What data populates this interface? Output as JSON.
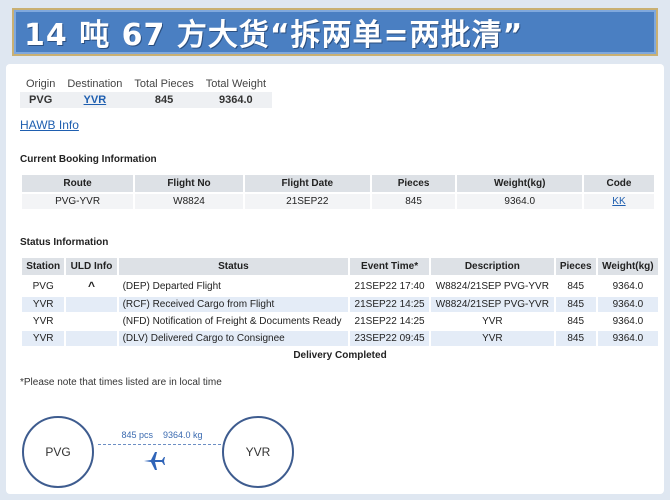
{
  "banner": {
    "text": "14 吨 67 方大货“拆两单=两批清”"
  },
  "summary": {
    "headers": [
      "Origin",
      "Destination",
      "Total Pieces",
      "Total Weight"
    ],
    "values": [
      "PVG",
      "YVR",
      "845",
      "9364.0"
    ]
  },
  "hawb_link": "HAWB Info",
  "booking": {
    "title": "Current Booking Information",
    "headers": [
      "Route",
      "Flight No",
      "Flight Date",
      "Pieces",
      "Weight(kg)",
      "Code"
    ],
    "row": [
      "PVG-YVR",
      "W8824",
      "21SEP22",
      "845",
      "9364.0",
      "KK"
    ]
  },
  "status": {
    "title": "Status Information",
    "headers": [
      "Station",
      "ULD Info",
      "Status",
      "Event Time*",
      "Description",
      "Pieces",
      "Weight(kg)"
    ],
    "rows": [
      {
        "station": "PVG",
        "uld": "^",
        "status": "(DEP) Departed Flight",
        "time": "21SEP22 17:40",
        "desc": "W8824/21SEP PVG-YVR",
        "pieces": "845",
        "weight": "9364.0"
      },
      {
        "station": "YVR",
        "uld": "",
        "status": "(RCF) Received Cargo from Flight",
        "time": "21SEP22 14:25",
        "desc": "W8824/21SEP PVG-YVR",
        "pieces": "845",
        "weight": "9364.0"
      },
      {
        "station": "YVR",
        "uld": "",
        "status": "(NFD) Notification of Freight & Documents Ready",
        "time": "21SEP22 14:25",
        "desc": "YVR",
        "pieces": "845",
        "weight": "9364.0"
      },
      {
        "station": "YVR",
        "uld": "",
        "status": "(DLV) Delivered Cargo to Consignee",
        "time": "23SEP22 09:45",
        "desc": "YVR",
        "pieces": "845",
        "weight": "9364.0"
      }
    ],
    "footer": "Delivery Completed"
  },
  "note": "*Please note that times listed are in local time",
  "route_diagram": {
    "origin": "PVG",
    "destination": "YVR",
    "pieces": "845 pcs",
    "weight": "9364.0 kg"
  },
  "colors": {
    "banner_bg": "#4a7fc2",
    "link": "#1f5fb0",
    "header_bg": "#dde1e6",
    "row_alt": "#e4ecf7"
  }
}
